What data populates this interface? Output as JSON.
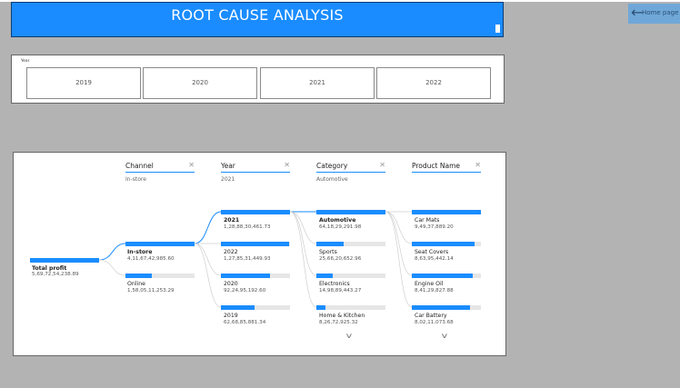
{
  "header": {
    "title": "ROOT CAUSE ANALYSIS",
    "home_label": "Home page"
  },
  "slicer": {
    "label": "Year",
    "options": [
      "2019",
      "2020",
      "2021",
      "2022"
    ]
  },
  "tree": {
    "root": {
      "label": "Total profit",
      "value": "5,69,72,54,238.89"
    },
    "columns": [
      {
        "title": "Channel",
        "selected": "In-store"
      },
      {
        "title": "Year",
        "selected": "2021"
      },
      {
        "title": "Category",
        "selected": "Automotive"
      },
      {
        "title": "Product Name",
        "selected": ""
      }
    ],
    "channel_nodes": [
      {
        "label": "In-store",
        "value": "4,11,67,42,985.60"
      },
      {
        "label": "Online",
        "value": "1,58,05,11,253.29"
      }
    ],
    "year_nodes": [
      {
        "label": "2021",
        "value": "1,28,88,30,461.73"
      },
      {
        "label": "2022",
        "value": "1,27,85,31,449.93"
      },
      {
        "label": "2020",
        "value": "92,24,95,192.60"
      },
      {
        "label": "2019",
        "value": "62,68,85,881.34"
      }
    ],
    "category_nodes": [
      {
        "label": "Automotive",
        "value": "64,18,29,291.98"
      },
      {
        "label": "Sports",
        "value": "25,66,20,652.96"
      },
      {
        "label": "Electronics",
        "value": "14,98,89,443.27"
      },
      {
        "label": "Home & Kitchen",
        "value": "8,26,72,925.32"
      }
    ],
    "product_nodes": [
      {
        "label": "Car Mats",
        "value": "9,49,37,889.20"
      },
      {
        "label": "Seat Covers",
        "value": "8,63,95,442.14"
      },
      {
        "label": "Engine Oil",
        "value": "8,41,29,827.88"
      },
      {
        "label": "Car Battery",
        "value": "8,02,11,073.68"
      }
    ]
  }
}
